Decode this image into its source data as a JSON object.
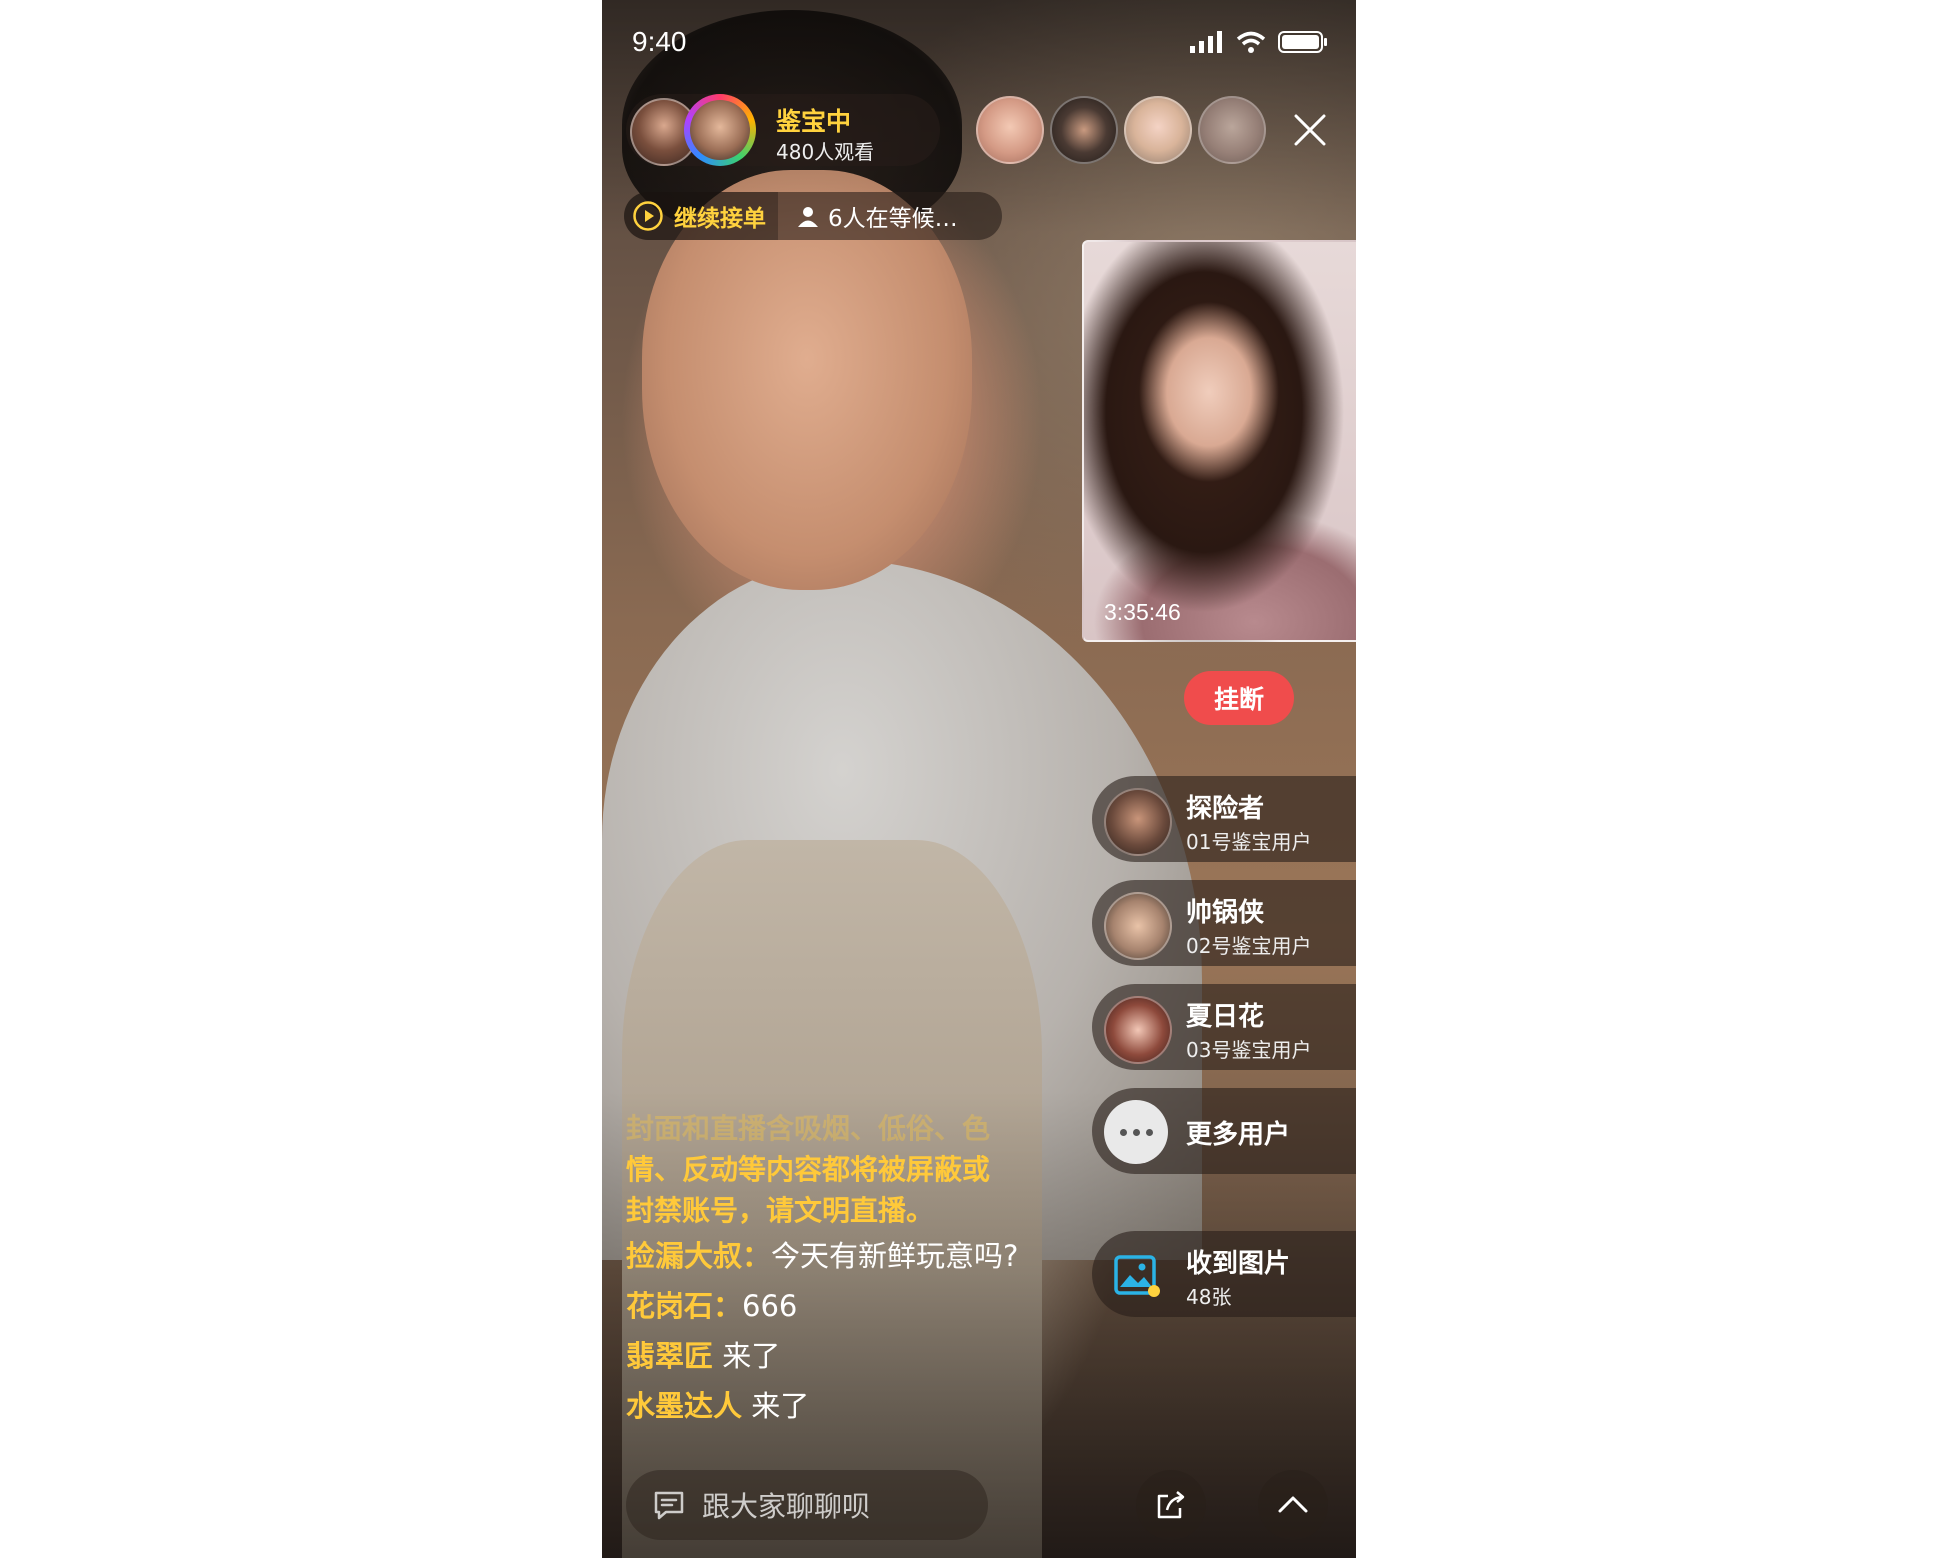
{
  "status_bar": {
    "time": "9:40"
  },
  "host": {
    "name": "鉴宝中",
    "viewers": "480人观看"
  },
  "orders": {
    "label": "继续接单",
    "waiting": "6人在等候…"
  },
  "video": {
    "duration": "3:35:46"
  },
  "hangup": {
    "label": "挂断"
  },
  "users": [
    {
      "name": "探险者",
      "sub": "01号鉴宝用户"
    },
    {
      "name": "帅锅侠",
      "sub": "02号鉴宝用户"
    },
    {
      "name": "夏日花",
      "sub": "03号鉴宝用户"
    }
  ],
  "more_users": {
    "label": "更多用户"
  },
  "received": {
    "label": "收到图片",
    "count": "48张"
  },
  "chat": {
    "notice_line1": "封面和直播含吸烟、低俗、色",
    "notice_line2": "情、反动等内容都将被屏蔽或",
    "notice_line3": "封禁账号，请文明直播。",
    "messages": [
      {
        "user": "捡漏大叔：",
        "text": "今天有新鲜玩意吗?"
      },
      {
        "user": "花岗石：",
        "text": "666"
      },
      {
        "user": "翡翠匠",
        "text": " 来了"
      },
      {
        "user": "水墨达人",
        "text": " 来了"
      }
    ]
  },
  "input": {
    "placeholder": "跟大家聊聊呗"
  },
  "colors": {
    "accent_yellow": "#ffd23e",
    "hangup_red": "#f04c4c"
  },
  "icons": [
    "signal-icon",
    "wifi-icon",
    "battery-icon",
    "close-icon",
    "play-icon",
    "person-icon",
    "more-icon",
    "image-icon",
    "comment-icon",
    "share-icon",
    "chevron-up-icon"
  ]
}
